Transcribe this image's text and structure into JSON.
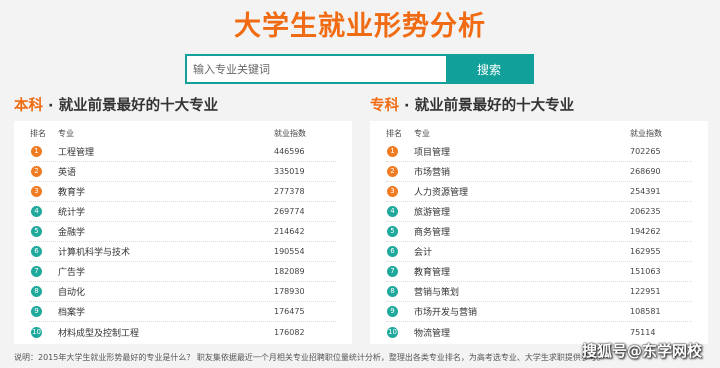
{
  "title": "大学生就业形势分析",
  "search": {
    "placeholder": "输入专业关键词",
    "button_label": "搜索"
  },
  "left_panel": {
    "accent": "本科",
    "heading": " · 就业前景最好的十大专业",
    "columns": {
      "rank": "排名",
      "name": "专业",
      "value": "就业指数"
    },
    "rows": [
      {
        "rank": "1",
        "name": "工程管理",
        "value": "446596"
      },
      {
        "rank": "2",
        "name": "英语",
        "value": "335019"
      },
      {
        "rank": "3",
        "name": "教育学",
        "value": "277378"
      },
      {
        "rank": "4",
        "name": "统计学",
        "value": "269774"
      },
      {
        "rank": "5",
        "name": "金融学",
        "value": "214642"
      },
      {
        "rank": "6",
        "name": "计算机科学与技术",
        "value": "190554"
      },
      {
        "rank": "7",
        "name": "广告学",
        "value": "182089"
      },
      {
        "rank": "8",
        "name": "自动化",
        "value": "178930"
      },
      {
        "rank": "9",
        "name": "档案学",
        "value": "176475"
      },
      {
        "rank": "10",
        "name": "材料成型及控制工程",
        "value": "176082"
      }
    ]
  },
  "right_panel": {
    "accent": "专科",
    "heading": " · 就业前景最好的十大专业",
    "columns": {
      "rank": "排名",
      "name": "专业",
      "value": "就业指数"
    },
    "rows": [
      {
        "rank": "1",
        "name": "项目管理",
        "value": "702265"
      },
      {
        "rank": "2",
        "name": "市场营销",
        "value": "268690"
      },
      {
        "rank": "3",
        "name": "人力资源管理",
        "value": "254391"
      },
      {
        "rank": "4",
        "name": "旅游管理",
        "value": "206235"
      },
      {
        "rank": "5",
        "name": "商务管理",
        "value": "194262"
      },
      {
        "rank": "6",
        "name": "会计",
        "value": "162955"
      },
      {
        "rank": "7",
        "name": "教育管理",
        "value": "151063"
      },
      {
        "rank": "8",
        "name": "营销与策划",
        "value": "122951"
      },
      {
        "rank": "9",
        "name": "市场开发与营销",
        "value": "108581"
      },
      {
        "rank": "10",
        "name": "物流管理",
        "value": "75114"
      }
    ]
  },
  "note": "说明：2015年大学生就业形势最好的专业是什么？ 职友集依据最近一个月相关专业招聘职位量统计分析，整理出各类专业排名，为高考选专业、大学生求职提供参考。",
  "watermark": "搜狐号@东学网校",
  "colors": {
    "accent": "#f06b12",
    "teal": "#12a19a",
    "badge_top": "#f07b22",
    "badge_rest": "#1fa99c"
  }
}
